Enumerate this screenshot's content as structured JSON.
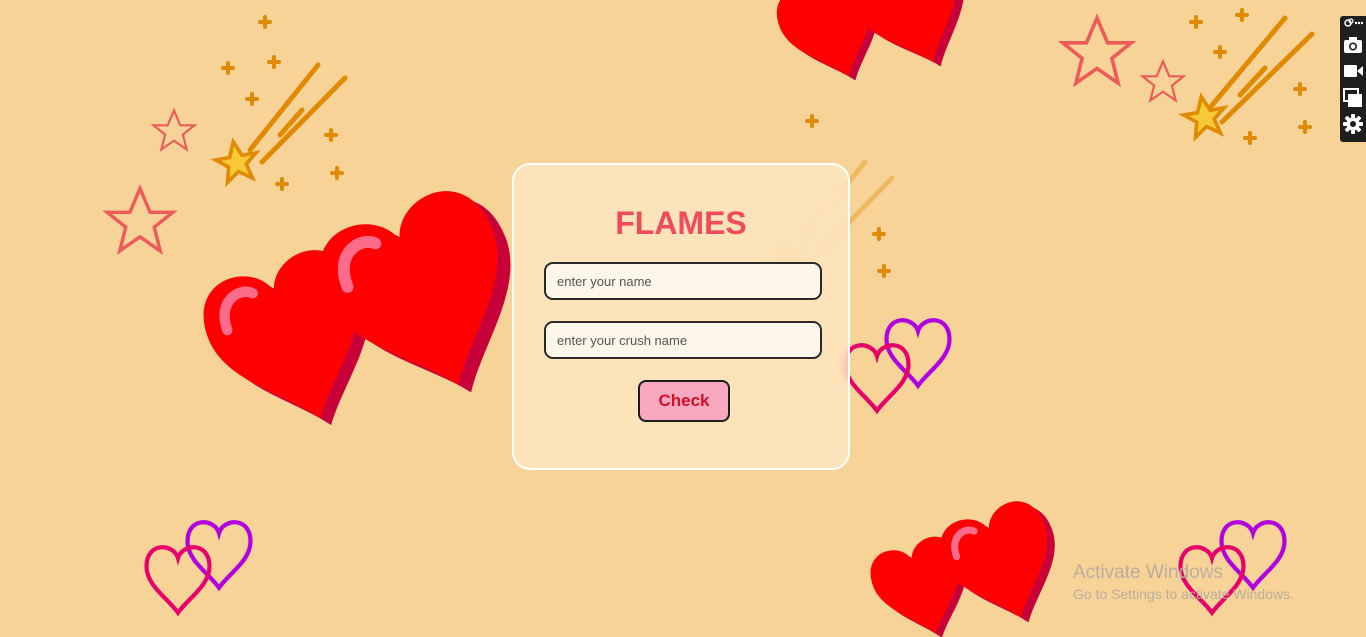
{
  "app": {
    "title": "FLAMES",
    "name_placeholder": "enter your name",
    "crush_placeholder": "enter your crush name",
    "check_label": "Check"
  },
  "toolbar": {
    "icons": [
      "link-icon",
      "more-icon",
      "camera-icon",
      "video-icon",
      "window-icon",
      "gear-icon"
    ]
  },
  "watermark": {
    "line1": "Activate Windows",
    "line2": "Go to Settings to activate Windows."
  },
  "colors": {
    "background": "#f8d398",
    "title": "#ec4c5c",
    "button": "#f8a8bf",
    "button_text": "#d0102a",
    "heart": "#ff0000"
  }
}
